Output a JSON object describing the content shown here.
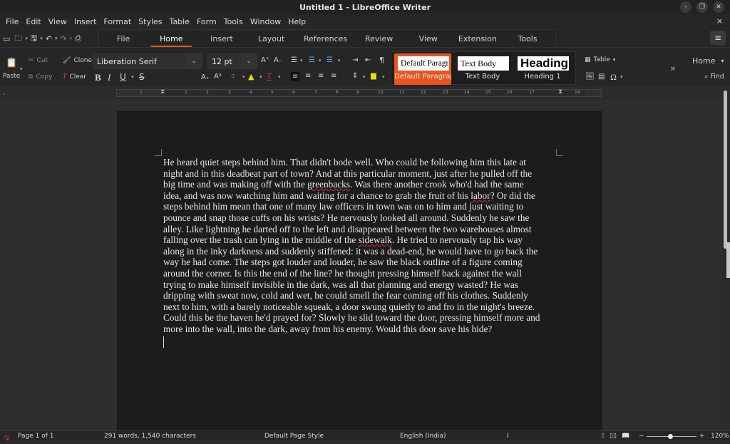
{
  "window": {
    "title": "Untitled 1 - LibreOffice Writer",
    "controls": [
      "minimize",
      "restore",
      "close"
    ]
  },
  "menubar": {
    "items": [
      "File",
      "Edit",
      "View",
      "Insert",
      "Format",
      "Styles",
      "Table",
      "Form",
      "Tools",
      "Window",
      "Help"
    ],
    "close_doc": "×"
  },
  "quick_access": {
    "icons": [
      "new-document-icon",
      "open-icon",
      "save-icon",
      "undo-icon",
      "redo-icon",
      "print-icon"
    ]
  },
  "tabs": {
    "items": [
      "File",
      "Home",
      "Insert",
      "Layout",
      "References",
      "Review",
      "View",
      "Extension",
      "Tools"
    ],
    "active": "Home"
  },
  "ribbon": {
    "paste_label": "Paste",
    "cut_label": "Cut",
    "copy_label": "Copy",
    "clone_label": "Clone",
    "clear_label": "Clear",
    "font_name": "Liberation Serif",
    "font_size": "12 pt",
    "bold": "B",
    "italic": "I",
    "underline": "U",
    "strikethrough": "S",
    "styles": [
      {
        "preview": "Default Paragraph Style",
        "label": "Default Paragraph Style",
        "selected": true
      },
      {
        "preview": "Text Body",
        "label": "Text Body",
        "selected": false
      },
      {
        "preview": "Heading",
        "label": "Heading 1",
        "selected": false
      }
    ],
    "table_label": "Table",
    "more": "»",
    "context_dropdown": "Home",
    "find_label": "Find",
    "accent_color": "#e95420"
  },
  "ruler": {
    "numbers": [
      "1",
      "1",
      "2",
      "3",
      "4",
      "5",
      "6",
      "7",
      "8",
      "9",
      "10",
      "11",
      "12",
      "13",
      "14",
      "15",
      "16",
      "17",
      "18"
    ]
  },
  "document": {
    "lines": [
      "He heard quiet steps behind him. That didn't bode well. Who could be following him this late at",
      "night and in this deadbeat part of town? And at this particular moment, just after he pulled off the",
      "big time and was making off with the greenbacks. Was there another crook who'd had the same",
      "idea, and was now watching him and waiting for a chance to grab the fruit of his labor? Or did the",
      "steps behind him mean that one of many law officers in town was on to him and just waiting to",
      "pounce and snap those cuffs on his wrists? He nervously looked all around. Suddenly he saw the",
      "alley. Like lightning he darted off to the left and disappeared between the two warehouses almost",
      "falling over the trash can lying in the middle of the sidewalk. He tried to nervously tap his way",
      "along in the inky darkness and suddenly stiffened: it was a dead-end, he would have to go back the",
      "way he had come. The steps got louder and louder, he saw the black outline of a figure coming",
      "around the corner. Is this the end of the line? he thought pressing himself back against the wall",
      "trying to make himself invisible in the dark, was all that planning and energy wasted? He was",
      "dripping with sweat now, cold and wet, he could smell the fear coming off his clothes. Suddenly",
      "next to him, with a barely noticeable squeak, a door swung quietly to and fro in the night's breeze.",
      "Could this be the haven he'd prayed for? Slowly he slid toward the door, pressing himself more and",
      "more into the wall, into the dark, away from his enemy. Would this door save his hide?"
    ],
    "misspelled": [
      "greenbacks",
      "labor",
      "sidewalk"
    ]
  },
  "statusbar": {
    "page": "Page 1 of 1",
    "word_count": "291 words, 1,540 characters",
    "page_style": "Default Page Style",
    "language": "English (India)",
    "insert_mode": "I",
    "zoom_minus": "−",
    "zoom_plus": "+",
    "zoom_level": "120%",
    "zoom_percent": 120
  }
}
